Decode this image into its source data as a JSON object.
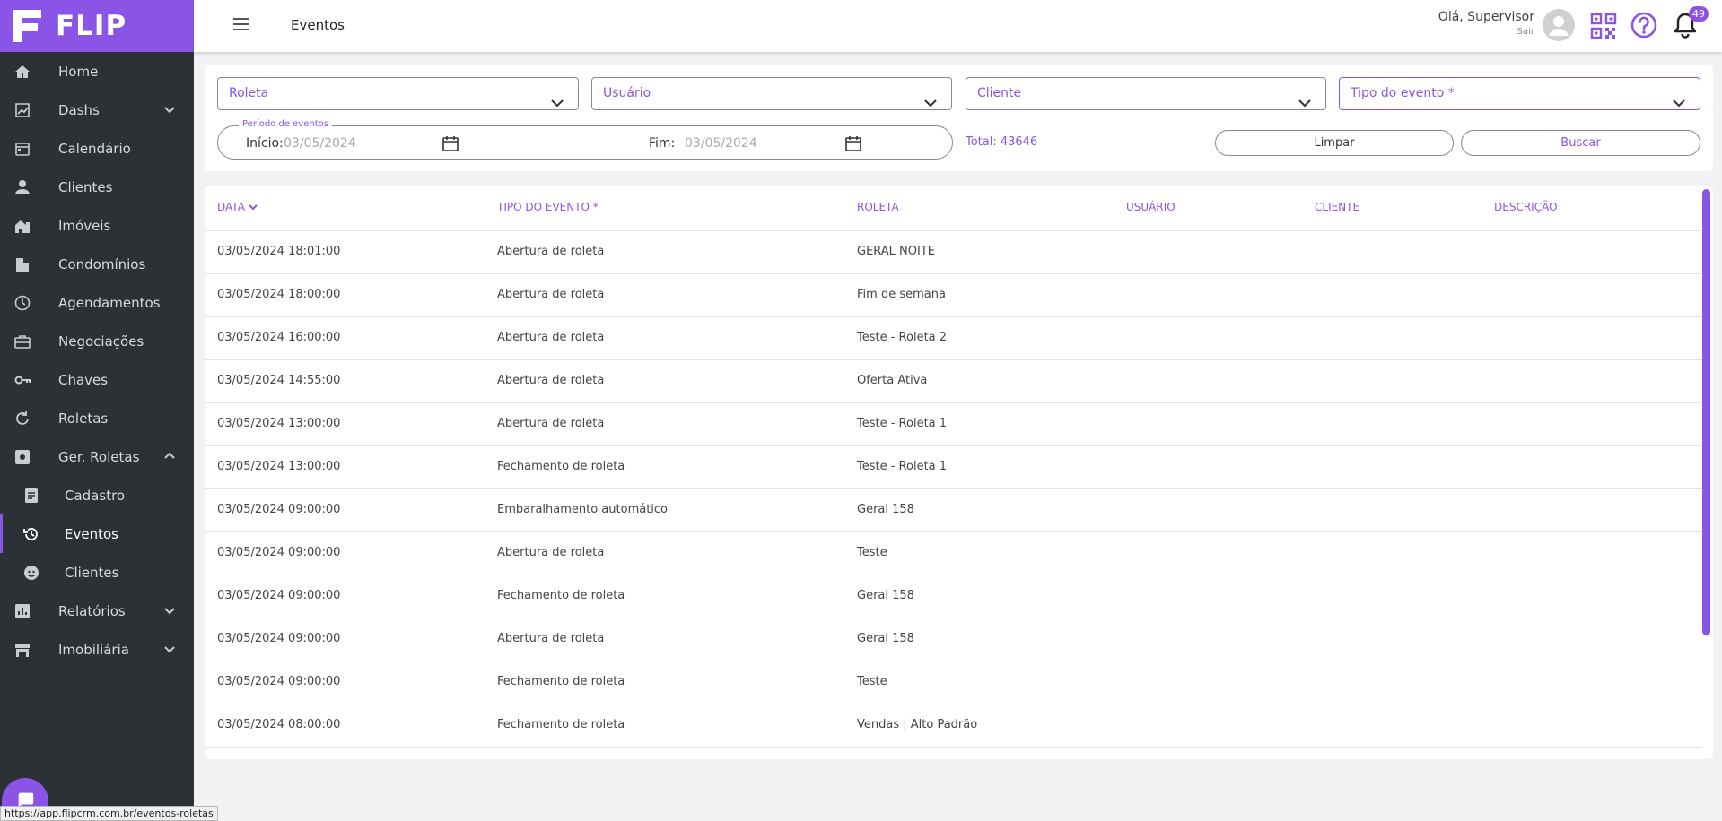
{
  "app": {
    "name": "FLIP"
  },
  "header": {
    "title": "Eventos",
    "greeting": "Olá, Supervisor",
    "logout": "Sair",
    "notifications_count": "49"
  },
  "sidebar": {
    "items": [
      {
        "label": "Home",
        "icon": "home-icon"
      },
      {
        "label": "Dashs",
        "icon": "chart-icon",
        "chevron": "down"
      },
      {
        "label": "Calendário",
        "icon": "calendar-icon"
      },
      {
        "label": "Clientes",
        "icon": "person-icon"
      },
      {
        "label": "Imóveis",
        "icon": "buildings-icon"
      },
      {
        "label": "Condomínios",
        "icon": "condo-icon"
      },
      {
        "label": "Agendamentos",
        "icon": "clock-icon"
      },
      {
        "label": "Negociações",
        "icon": "briefcase-icon"
      },
      {
        "label": "Chaves",
        "icon": "key-icon"
      },
      {
        "label": "Roletas",
        "icon": "refresh-icon"
      },
      {
        "label": "Ger. Roletas",
        "icon": "gear-box-icon",
        "chevron": "up"
      },
      {
        "label": "Cadastro",
        "icon": "document-icon",
        "sub": true
      },
      {
        "label": "Eventos",
        "icon": "history-icon",
        "sub": true,
        "active": true
      },
      {
        "label": "Clientes",
        "icon": "face-icon",
        "sub": true
      },
      {
        "label": "Relatórios",
        "icon": "report-icon",
        "chevron": "down"
      },
      {
        "label": "Imobiliária",
        "icon": "store-icon",
        "chevron": "down"
      }
    ]
  },
  "filters": {
    "roleta": "Roleta",
    "usuario": "Usuário",
    "cliente": "Cliente",
    "tipo_evento": "Tipo do evento *",
    "period_label": "Período de eventos",
    "start_label": "Início:",
    "start_value": "03/05/2024",
    "end_label": "Fim:",
    "end_value": "03/05/2024",
    "total": "Total: 43646",
    "clear_label": "Limpar",
    "search_label": "Buscar"
  },
  "table": {
    "columns": [
      "DATA",
      "TIPO DO EVENTO *",
      "ROLETA",
      "USUÁRIO",
      "CLIENTE",
      "DESCRIÇÃO"
    ],
    "rows": [
      [
        "03/05/2024 18:01:00",
        "Abertura de roleta",
        "GERAL NOITE",
        "",
        "",
        ""
      ],
      [
        "03/05/2024 18:00:00",
        "Abertura de roleta",
        "Fim de semana",
        "",
        "",
        ""
      ],
      [
        "03/05/2024 16:00:00",
        "Abertura de roleta",
        "Teste - Roleta 2",
        "",
        "",
        ""
      ],
      [
        "03/05/2024 14:55:00",
        "Abertura de roleta",
        "Oferta Ativa",
        "",
        "",
        ""
      ],
      [
        "03/05/2024 13:00:00",
        "Abertura de roleta",
        "Teste - Roleta 1",
        "",
        "",
        ""
      ],
      [
        "03/05/2024 13:00:00",
        "Fechamento de roleta",
        "Teste - Roleta 1",
        "",
        "",
        ""
      ],
      [
        "03/05/2024 09:00:00",
        "Embaralhamento automático",
        "Geral 158",
        "",
        "",
        ""
      ],
      [
        "03/05/2024 09:00:00",
        "Abertura de roleta",
        "Teste",
        "",
        "",
        ""
      ],
      [
        "03/05/2024 09:00:00",
        "Fechamento de roleta",
        "Geral 158",
        "",
        "",
        ""
      ],
      [
        "03/05/2024 09:00:00",
        "Abertura de roleta",
        "Geral 158",
        "",
        "",
        ""
      ],
      [
        "03/05/2024 09:00:00",
        "Fechamento de roleta",
        "Teste",
        "",
        "",
        ""
      ],
      [
        "03/05/2024 08:00:00",
        "Fechamento de roleta",
        "Vendas | Alto Padrão",
        "",
        "",
        ""
      ]
    ]
  },
  "status_bar": {
    "url": "https://app.flipcrm.com.br/eventos-roletas"
  },
  "colors": {
    "accent": "#8a55e6",
    "sidebar_bg": "#2c3136",
    "page_bg": "#f2f2f5"
  }
}
